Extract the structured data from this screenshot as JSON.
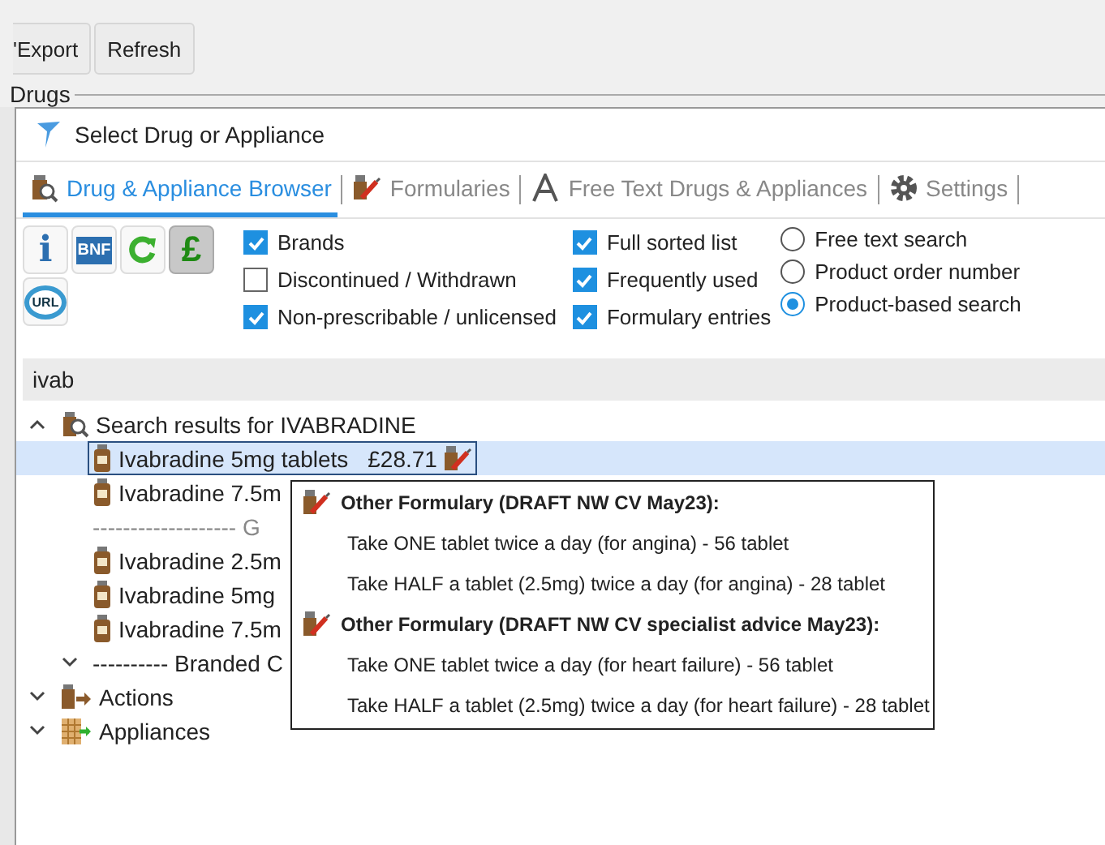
{
  "toolbar": {
    "buttons": [
      "'Export",
      "Refresh"
    ]
  },
  "group_label": "Drugs",
  "dialog": {
    "title": "Select Drug or Appliance"
  },
  "tabs": [
    {
      "label": "Drug & Appliance Browser",
      "kind": "browser",
      "selected": true
    },
    {
      "label": "Formularies",
      "kind": "formulary",
      "selected": false
    },
    {
      "label": "Free Text Drugs & Appliances",
      "kind": "freetext",
      "selected": false
    },
    {
      "label": "Settings",
      "kind": "settings",
      "selected": false
    }
  ],
  "tool_buttons": [
    {
      "kind": "info",
      "label": "i",
      "pressed": false
    },
    {
      "kind": "bnf",
      "label": "BNF",
      "pressed": false
    },
    {
      "kind": "refresh",
      "pressed": false
    },
    {
      "kind": "price",
      "label": "£",
      "pressed": true
    },
    {
      "kind": "url",
      "label": "URL",
      "pressed": false
    }
  ],
  "options_column_1": [
    {
      "label": "Brands",
      "checked": true
    },
    {
      "label": "Discontinued / Withdrawn",
      "checked": false
    },
    {
      "label": "Non-prescribable / unlicensed",
      "checked": true
    }
  ],
  "options_column_2": [
    {
      "label": "Full sorted list",
      "checked": true
    },
    {
      "label": "Frequently used",
      "checked": true
    },
    {
      "label": "Formulary entries",
      "checked": true
    }
  ],
  "search_modes": [
    {
      "label": "Free text search",
      "selected": false
    },
    {
      "label": "Product order number",
      "selected": false
    },
    {
      "label": "Product-based search",
      "selected": true
    }
  ],
  "search": {
    "value": "ivab"
  },
  "tree": [
    {
      "kind": "search",
      "label": "Search results for IVABRADINE",
      "expanded": true,
      "children": [
        {
          "kind": "drug",
          "label": "Ivabradine 5mg tablets",
          "price": "£28.71",
          "formulary": true,
          "selected": true
        },
        {
          "kind": "drug",
          "label": "Ivabradine 7.5m",
          "formulary": false,
          "selected": false
        },
        {
          "kind": "separator",
          "label": "------------------- G",
          "selected": false
        },
        {
          "kind": "drug",
          "label": "Ivabradine 2.5m",
          "formulary": false,
          "selected": false
        },
        {
          "kind": "drug",
          "label": "Ivabradine 5mg",
          "formulary": false,
          "selected": false
        },
        {
          "kind": "drug",
          "label": "Ivabradine 7.5m",
          "formulary": false,
          "selected": false
        },
        {
          "kind": "group",
          "label": "---------- Branded C",
          "expanded": false,
          "selected": false
        }
      ]
    },
    {
      "kind": "actions",
      "label": "Actions",
      "expanded": false
    },
    {
      "kind": "appliances",
      "label": "Appliances",
      "expanded": false
    }
  ],
  "tooltip": {
    "sections": [
      {
        "title": "Other Formulary (DRAFT NW CV May23):",
        "lines": [
          "Take ONE tablet twice a day (for angina) - 56 tablet",
          "Take HALF a tablet (2.5mg)  twice a day (for angina) - 28 tablet"
        ]
      },
      {
        "title": "Other Formulary (DRAFT NW CV specialist advice May23):",
        "lines": [
          "Take ONE tablet twice a day (for heart failure) - 56 tablet",
          "Take HALF a tablet (2.5mg) twice a day (for heart failure) - 28 tablet"
        ]
      }
    ]
  }
}
